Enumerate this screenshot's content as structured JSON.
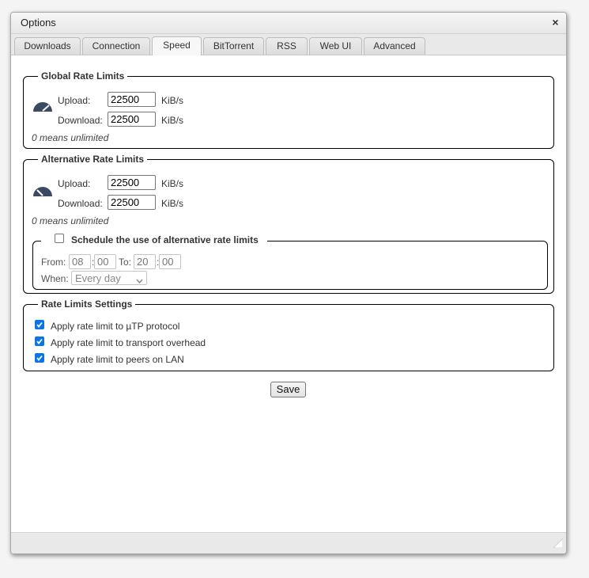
{
  "window": {
    "title": "Options",
    "close_symbol": "×"
  },
  "tabs": [
    {
      "label": "Downloads",
      "active": false
    },
    {
      "label": "Connection",
      "active": false
    },
    {
      "label": "Speed",
      "active": true
    },
    {
      "label": "BitTorrent",
      "active": false
    },
    {
      "label": "RSS",
      "active": false
    },
    {
      "label": "Web UI",
      "active": false
    },
    {
      "label": "Advanced",
      "active": false
    }
  ],
  "global_limits": {
    "legend": "Global Rate Limits",
    "icon": "speedometer-icon",
    "upload_label": "Upload:",
    "upload_value": "22500",
    "upload_unit": "KiB/s",
    "download_label": "Download:",
    "download_value": "22500",
    "download_unit": "KiB/s",
    "note": "0 means unlimited"
  },
  "alt_limits": {
    "legend": "Alternative Rate Limits",
    "icon": "slow-speedometer-icon",
    "upload_label": "Upload:",
    "upload_value": "22500",
    "upload_unit": "KiB/s",
    "download_label": "Download:",
    "download_value": "22500",
    "download_unit": "KiB/s",
    "note": "0 means unlimited",
    "schedule": {
      "legend": "Schedule the use of alternative rate limits",
      "enabled": false,
      "from_label": "From:",
      "from_hour": "08",
      "from_minute": "00",
      "to_label": "To:",
      "to_hour": "20",
      "to_minute": "00",
      "separator": ":",
      "when_label": "When:",
      "when_value": "Every day"
    }
  },
  "settings": {
    "legend": "Rate Limits Settings",
    "options": [
      {
        "label": "Apply rate limit to µTP protocol",
        "checked": true
      },
      {
        "label": "Apply rate limit to transport overhead",
        "checked": true
      },
      {
        "label": "Apply rate limit to peers on LAN",
        "checked": true
      }
    ]
  },
  "save_label": "Save",
  "colors": {
    "accent": "#0b74e6",
    "icon": "#3b4a63"
  }
}
